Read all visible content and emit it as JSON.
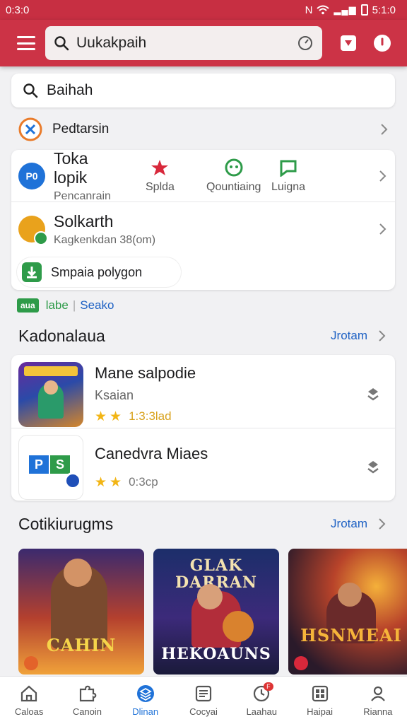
{
  "status_bar": {
    "time": "0:3:0",
    "right_text": "5:1:0"
  },
  "app_bar": {
    "search_text": "Uukakpaih"
  },
  "search_box": {
    "text": "Baihah"
  },
  "row_plain": {
    "label": "Pedtarsin"
  },
  "features": {
    "title": "Toka lopik",
    "subtitle": "Pencanrain",
    "shortcuts": [
      "Splda",
      "Qountiaing",
      "Luigna"
    ],
    "item2_title": "Solkarth",
    "item2_subtitle": "Kagkenkdan 38(om)",
    "pill_label": "Smpaia polygon"
  },
  "tags": {
    "green": "aua",
    "text1": "labe",
    "text2": "Seako"
  },
  "section1": {
    "title": "Kadonalaua",
    "link": "Jrotam"
  },
  "apps": [
    {
      "name": "Mane salpodie",
      "sub": "Ksaian",
      "rating_text": "1:3:3lad"
    },
    {
      "name": "Canedvra Miaes",
      "rating_text": "0:3cp"
    }
  ],
  "section2": {
    "title": "Cotikiurugms",
    "link": "Jrotam"
  },
  "games": [
    {
      "title_line1": "CAHIN",
      "title_line2": ""
    },
    {
      "top_title": "GLAK DARRAN",
      "title_line1": "HEKOAUNS"
    },
    {
      "title_line1": "HSNMEAI"
    }
  ],
  "bottom_nav": [
    {
      "label": "Caloas",
      "icon": "home-icon"
    },
    {
      "label": "Canoin",
      "icon": "puzzle-icon"
    },
    {
      "label": "Dlinan",
      "icon": "layers-icon",
      "active": true
    },
    {
      "label": "Cocyai",
      "icon": "news-icon"
    },
    {
      "label": "Laahau",
      "icon": "clock-icon",
      "badge": "F"
    },
    {
      "label": "Haipai",
      "icon": "grid-icon"
    },
    {
      "label": "Rianna",
      "icon": "person-icon"
    }
  ],
  "colors": {
    "brand": "#cc3346",
    "link": "#1f62c4",
    "active_nav": "#1f72d8",
    "star": "#f2b515"
  }
}
